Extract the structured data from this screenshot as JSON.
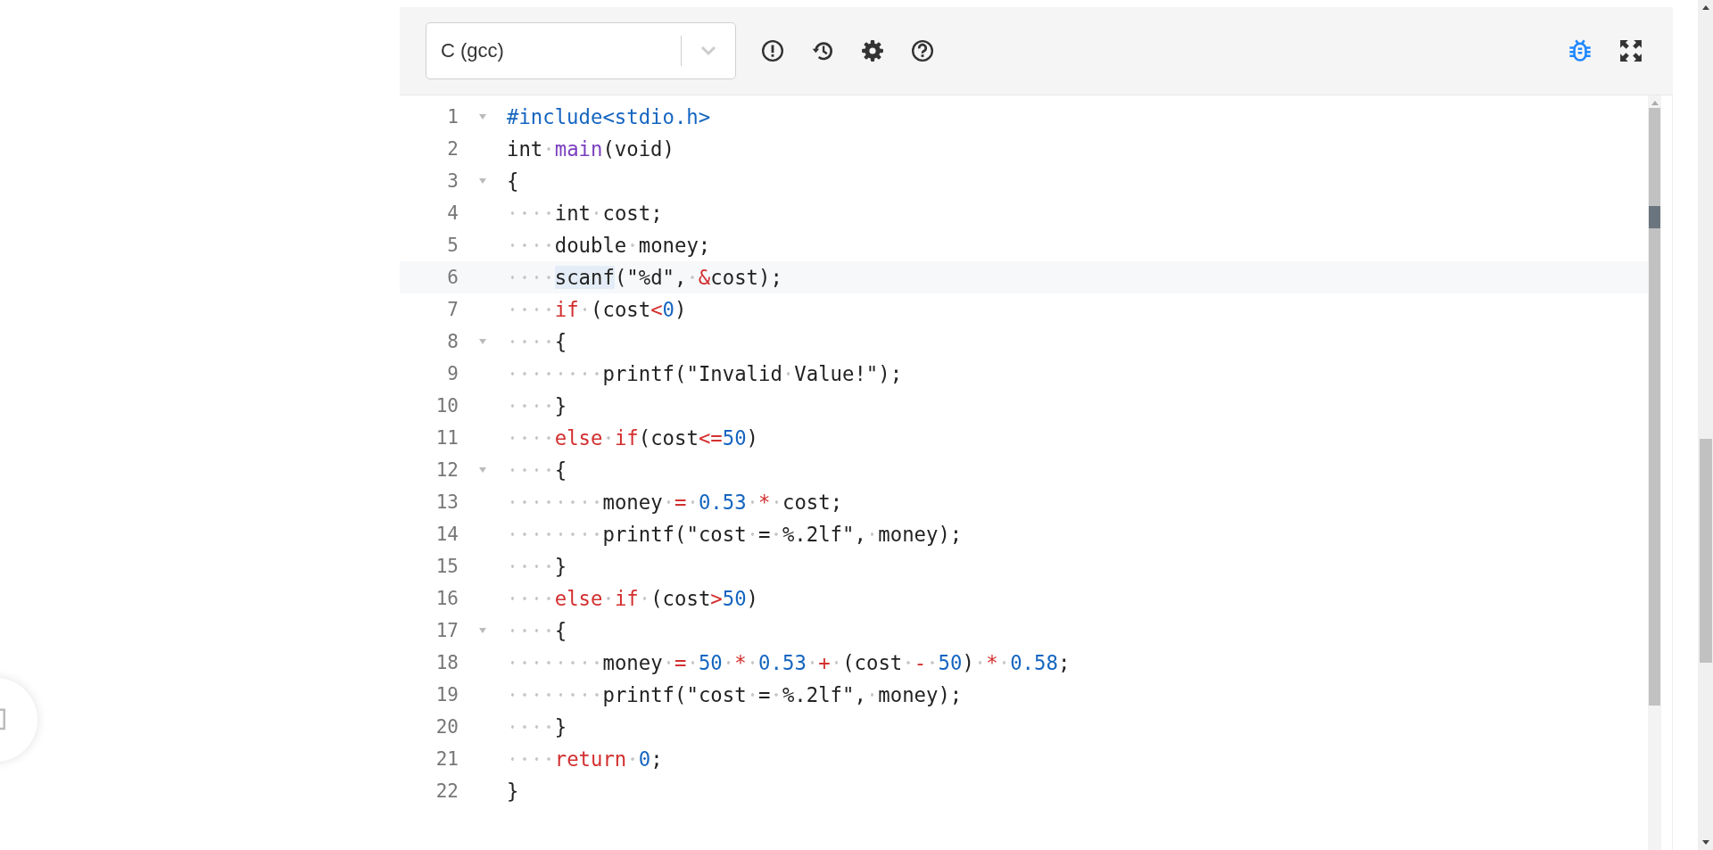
{
  "toolbar": {
    "language_select": {
      "value": "C (gcc)"
    },
    "bug_mode": {
      "on": true
    }
  },
  "editor": {
    "lines": [
      {
        "number": "1",
        "foldable": true,
        "active": false,
        "tokens": [
          {
            "kind": "preproc",
            "text": "#include<stdio.h>"
          }
        ]
      },
      {
        "number": "2",
        "foldable": false,
        "active": false,
        "tokens": [
          {
            "kind": "plain",
            "text": "int "
          },
          {
            "kind": "func",
            "text": "main"
          },
          {
            "kind": "plain",
            "text": "(void)"
          }
        ]
      },
      {
        "number": "3",
        "foldable": true,
        "active": false,
        "tokens": [
          {
            "kind": "plain",
            "text": "{"
          }
        ]
      },
      {
        "number": "4",
        "foldable": false,
        "active": false,
        "tokens": [
          {
            "kind": "plain",
            "text": "    int cost;"
          }
        ]
      },
      {
        "number": "5",
        "foldable": false,
        "active": false,
        "tokens": [
          {
            "kind": "plain",
            "text": "    double money;"
          }
        ]
      },
      {
        "number": "6",
        "foldable": false,
        "active": true,
        "tokens": [
          {
            "kind": "match",
            "text": "    scanf"
          },
          {
            "kind": "plain",
            "text": "(\"%d\", "
          },
          {
            "kind": "op",
            "text": "&"
          },
          {
            "kind": "plain",
            "text": "cost);"
          }
        ]
      },
      {
        "number": "7",
        "foldable": false,
        "active": false,
        "tokens": [
          {
            "kind": "keyword",
            "text": "    if"
          },
          {
            "kind": "plain",
            "text": " (cost"
          },
          {
            "kind": "op",
            "text": "<"
          },
          {
            "kind": "number",
            "text": "0"
          },
          {
            "kind": "plain",
            "text": ")"
          }
        ]
      },
      {
        "number": "8",
        "foldable": true,
        "active": false,
        "tokens": [
          {
            "kind": "plain",
            "text": "    {"
          }
        ]
      },
      {
        "number": "9",
        "foldable": false,
        "active": false,
        "tokens": [
          {
            "kind": "plain",
            "text": "        printf(\"Invalid Value!\");"
          }
        ]
      },
      {
        "number": "10",
        "foldable": false,
        "active": false,
        "tokens": [
          {
            "kind": "plain",
            "text": "    }"
          }
        ]
      },
      {
        "number": "11",
        "foldable": false,
        "active": false,
        "tokens": [
          {
            "kind": "keyword",
            "text": "    else if"
          },
          {
            "kind": "plain",
            "text": "(cost"
          },
          {
            "kind": "op",
            "text": "<="
          },
          {
            "kind": "number",
            "text": "50"
          },
          {
            "kind": "plain",
            "text": ")"
          }
        ]
      },
      {
        "number": "12",
        "foldable": true,
        "active": false,
        "tokens": [
          {
            "kind": "plain",
            "text": "    {"
          }
        ]
      },
      {
        "number": "13",
        "foldable": false,
        "active": false,
        "tokens": [
          {
            "kind": "plain",
            "text": "        money "
          },
          {
            "kind": "op",
            "text": "="
          },
          {
            "kind": "number",
            "text": " 0.53"
          },
          {
            "kind": "op",
            "text": " *"
          },
          {
            "kind": "plain",
            "text": " cost;"
          }
        ]
      },
      {
        "number": "14",
        "foldable": false,
        "active": false,
        "tokens": [
          {
            "kind": "plain",
            "text": "        printf(\"cost = %.2lf\", money);"
          }
        ]
      },
      {
        "number": "15",
        "foldable": false,
        "active": false,
        "tokens": [
          {
            "kind": "plain",
            "text": "    }"
          }
        ]
      },
      {
        "number": "16",
        "foldable": false,
        "active": false,
        "tokens": [
          {
            "kind": "keyword",
            "text": "    else if"
          },
          {
            "kind": "plain",
            "text": " (cost"
          },
          {
            "kind": "op",
            "text": ">"
          },
          {
            "kind": "number",
            "text": "50"
          },
          {
            "kind": "plain",
            "text": ")"
          }
        ]
      },
      {
        "number": "17",
        "foldable": true,
        "active": false,
        "tokens": [
          {
            "kind": "plain",
            "text": "    {"
          }
        ]
      },
      {
        "number": "18",
        "foldable": false,
        "active": false,
        "tokens": [
          {
            "kind": "plain",
            "text": "        money "
          },
          {
            "kind": "op",
            "text": "="
          },
          {
            "kind": "number",
            "text": " 50"
          },
          {
            "kind": "op",
            "text": " *"
          },
          {
            "kind": "number",
            "text": " 0.53"
          },
          {
            "kind": "op",
            "text": " +"
          },
          {
            "kind": "plain",
            "text": " (cost "
          },
          {
            "kind": "op",
            "text": "-"
          },
          {
            "kind": "number",
            "text": " 50"
          },
          {
            "kind": "plain",
            "text": ") "
          },
          {
            "kind": "op",
            "text": "*"
          },
          {
            "kind": "number",
            "text": " 0.58"
          },
          {
            "kind": "plain",
            "text": ";"
          }
        ]
      },
      {
        "number": "19",
        "foldable": false,
        "active": false,
        "tokens": [
          {
            "kind": "plain",
            "text": "        printf(\"cost = %.2lf\", money);"
          }
        ]
      },
      {
        "number": "20",
        "foldable": false,
        "active": false,
        "tokens": [
          {
            "kind": "plain",
            "text": "    }"
          }
        ]
      },
      {
        "number": "21",
        "foldable": false,
        "active": false,
        "tokens": [
          {
            "kind": "keyword",
            "text": "    return"
          },
          {
            "kind": "number",
            "text": " 0"
          },
          {
            "kind": "plain",
            "text": ";"
          }
        ]
      },
      {
        "number": "22",
        "foldable": false,
        "active": false,
        "tokens": [
          {
            "kind": "plain",
            "text": "}"
          }
        ]
      }
    ]
  }
}
